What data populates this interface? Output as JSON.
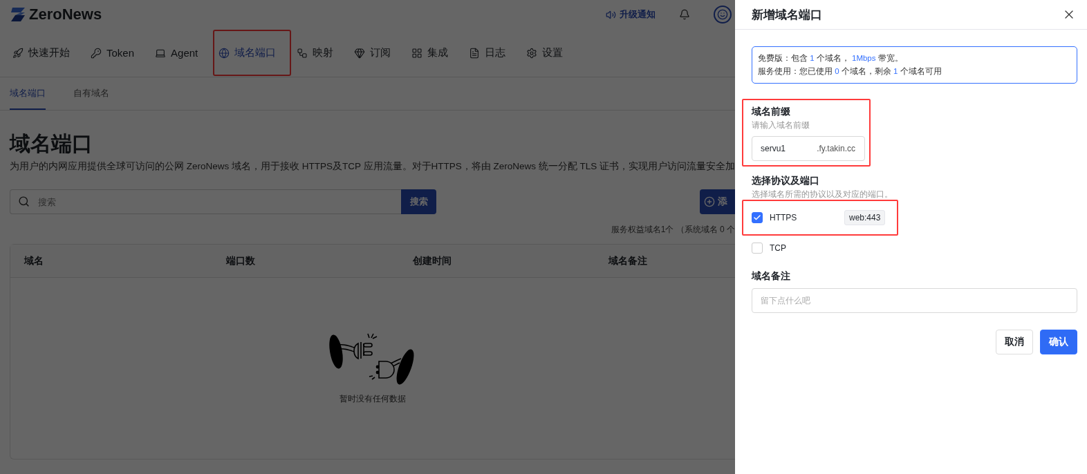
{
  "app": {
    "logo": "ZeroNews",
    "notice": "升级通知"
  },
  "nav": [
    {
      "label": "快速开始",
      "selected": false,
      "highlighted": false
    },
    {
      "label": "Token",
      "selected": false,
      "highlighted": false
    },
    {
      "label": "Agent",
      "selected": false,
      "highlighted": false
    },
    {
      "label": "域名端口",
      "selected": true,
      "highlighted": true
    },
    {
      "label": "映射",
      "selected": false,
      "highlighted": false
    },
    {
      "label": "订阅",
      "selected": false,
      "highlighted": false
    },
    {
      "label": "集成",
      "selected": false,
      "highlighted": false
    },
    {
      "label": "日志",
      "selected": false,
      "highlighted": false
    },
    {
      "label": "设置",
      "selected": false,
      "highlighted": false
    }
  ],
  "subtabs": [
    {
      "label": "域名端口",
      "selected": true
    },
    {
      "label": "自有域名",
      "selected": false
    }
  ],
  "page": {
    "title": "域名端口",
    "description": "为用户的内网应用提供全球可访问的公网 ZeroNews 域名，用于接收 HTTPS及TCP 应用流量。对于HTTPS，将由 ZeroNews 统一分配 TLS 证书，实现用户访问流量安全加",
    "search_placeholder": "搜索",
    "search_button": "搜索",
    "add_button": "添",
    "quota": "服务权益域名1个 （系统域名 0 个"
  },
  "table": {
    "columns": [
      "域名",
      "端口数",
      "创建时间",
      "域名备注"
    ],
    "empty_text": "暂时没有任何数据"
  },
  "drawer": {
    "title": "新增域名端口",
    "info": [
      [
        {
          "text": "免费版：包含 ",
          "emphasis": false
        },
        {
          "text": "1",
          "emphasis": true
        },
        {
          "text": " 个域名， ",
          "emphasis": false
        },
        {
          "text": "1Mbps",
          "emphasis": true
        },
        {
          "text": " 带宽。",
          "emphasis": false
        }
      ],
      [
        {
          "text": "服务使用：您已使用 ",
          "emphasis": false
        },
        {
          "text": "0",
          "emphasis": true
        },
        {
          "text": " 个域名，剩余 ",
          "emphasis": false
        },
        {
          "text": "1",
          "emphasis": true
        },
        {
          "text": " 个域名可用",
          "emphasis": false
        }
      ]
    ],
    "prefix": {
      "label": "域名前缀",
      "hint": "请输入域名前缀",
      "value": "servu1",
      "suffix": ".fy.takin.cc",
      "highlighted": true
    },
    "protocol": {
      "label": "选择协议及端口",
      "hint": "选择域名所需的协议以及对应的端口。",
      "options": [
        {
          "label": "HTTPS",
          "checked": true,
          "port": "web:443",
          "highlighted": true
        },
        {
          "label": "TCP",
          "checked": false,
          "highlighted": false
        }
      ]
    },
    "note": {
      "label": "域名备注",
      "placeholder": "留下点什么吧"
    },
    "cancel": "取消",
    "confirm": "确认"
  }
}
